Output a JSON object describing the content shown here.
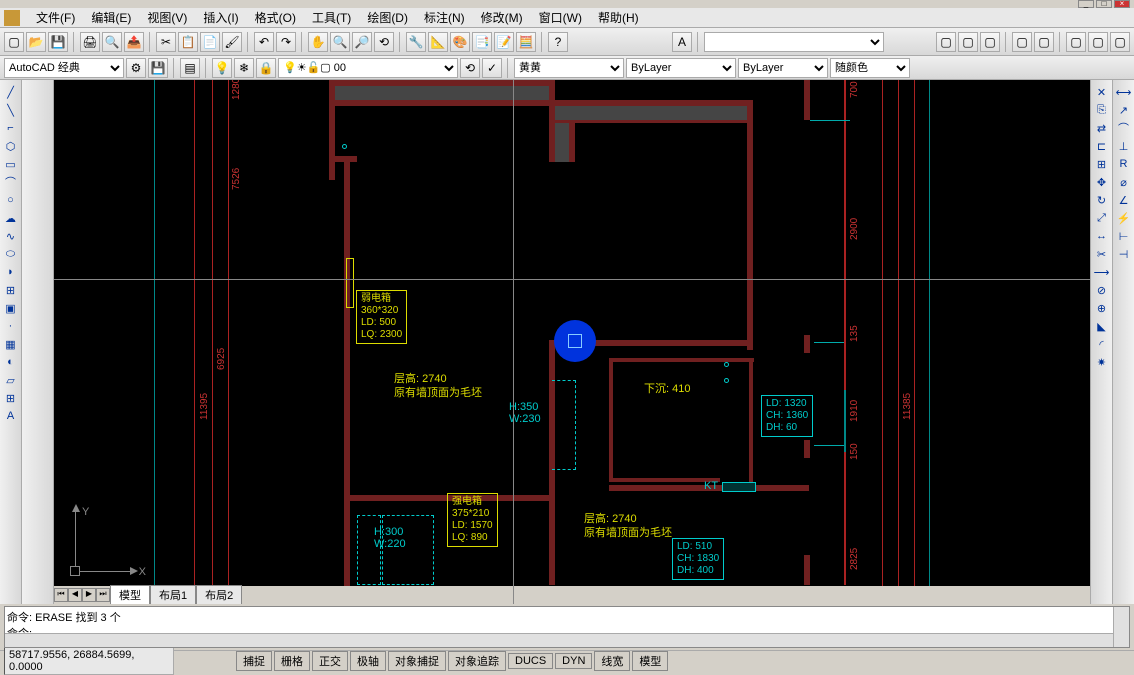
{
  "window": {
    "min": "_",
    "restore": "□",
    "close": "×"
  },
  "menu": {
    "file": "文件(F)",
    "edit": "编辑(E)",
    "view": "视图(V)",
    "insert": "插入(I)",
    "format": "格式(O)",
    "tools": "工具(T)",
    "draw": "绘图(D)",
    "dimension": "标注(N)",
    "modify": "修改(M)",
    "window": "窗口(W)",
    "help": "帮助(H)"
  },
  "workspace": {
    "name": "AutoCAD 经典"
  },
  "layer_dropdown": {
    "icon_label": "0",
    "layer_name": "0"
  },
  "properties": {
    "color_label": "黄",
    "linetype": "ByLayer",
    "lineweight": "ByLayer",
    "plot_style": "随颜色"
  },
  "drawing": {
    "box1": {
      "title": "弱电箱",
      "size": "360*320",
      "ld": "LD: 500",
      "lq": "LQ: 2300"
    },
    "box2": {
      "title": "强电箱",
      "size": "375*210",
      "ld": "LD: 1570",
      "lq": "LQ: 890"
    },
    "room1": {
      "height": "层高: 2740",
      "note": "原有墙顶面为毛坯"
    },
    "room2": {
      "height": "层高: 2740",
      "note": "原有墙顶面为毛坯"
    },
    "sunken": "下沉: 410",
    "dim1": {
      "h": "H:350",
      "w": "W:230"
    },
    "dim2": {
      "h": "H:300",
      "w": "W:220"
    },
    "box3": {
      "ld": "LD: 1320",
      "ch": "CH: 1360",
      "dh": "DH: 60"
    },
    "box4": {
      "ld": "LD: 510",
      "ch": "CH: 1830",
      "dh": "DH: 400"
    },
    "kt_label": "KT",
    "dims": {
      "d1280": "1280",
      "d7526": "7526",
      "d6925": "6925",
      "d11395": "11395",
      "d700": "700",
      "d2900": "2900",
      "d135": "135",
      "d1910": "1910",
      "d11385": "11385",
      "d150": "150",
      "d2825": "2825"
    },
    "ucs": {
      "x": "X",
      "y": "Y"
    }
  },
  "tabs": {
    "model": "模型",
    "layout1": "布局1",
    "layout2": "布局2"
  },
  "command": {
    "line1": "命令:  ERASE 找到 3 个",
    "line2": "命令:"
  },
  "status": {
    "coords": "58717.9556, 26884.5699, 0.0000",
    "snap": "捕捉",
    "grid": "栅格",
    "ortho": "正交",
    "polar": "极轴",
    "osnap": "对象捕捉",
    "otrack": "对象追踪",
    "ducs": "DUCS",
    "dyn": "DYN",
    "lwt": "线宽",
    "model": "模型"
  }
}
